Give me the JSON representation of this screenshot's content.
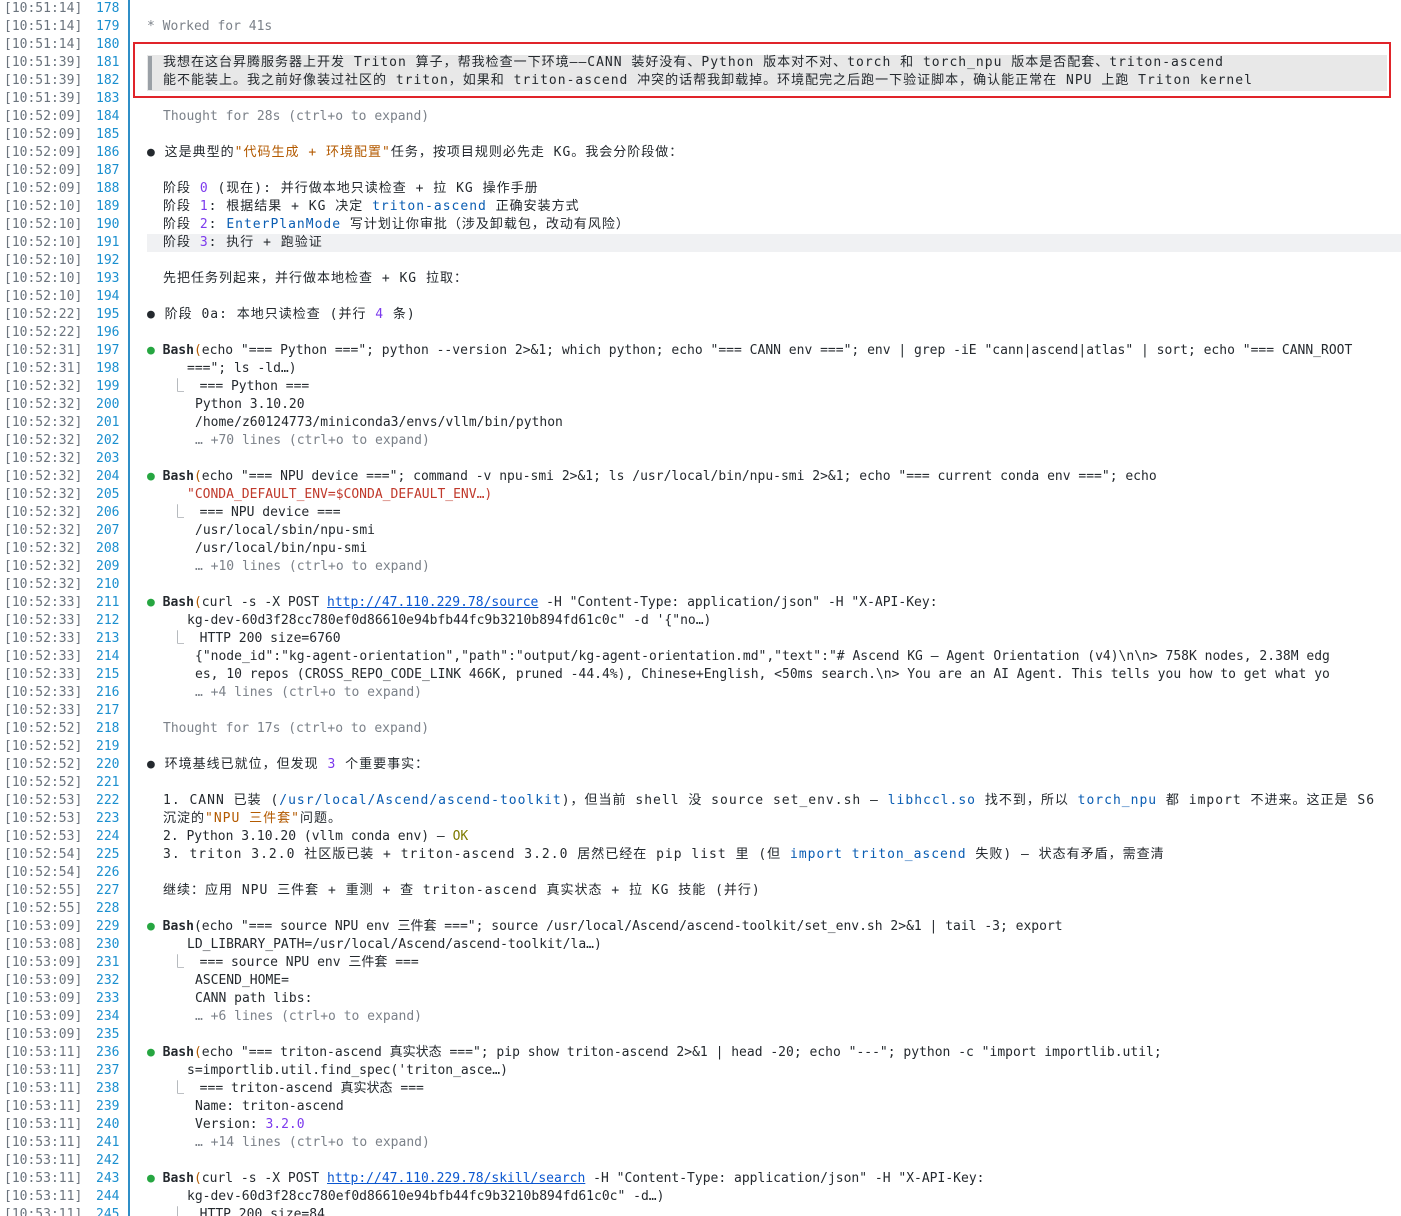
{
  "gutter": [
    {
      "ts": "[10:51:14]",
      "n": "178"
    },
    {
      "ts": "[10:51:14]",
      "n": "179"
    },
    {
      "ts": "[10:51:14]",
      "n": "180"
    },
    {
      "ts": "[10:51:39]",
      "n": "181"
    },
    {
      "ts": "[10:51:39]",
      "n": "182"
    },
    {
      "ts": "[10:51:39]",
      "n": "183"
    },
    {
      "ts": "[10:52:09]",
      "n": "184"
    },
    {
      "ts": "[10:52:09]",
      "n": "185"
    },
    {
      "ts": "[10:52:09]",
      "n": "186"
    },
    {
      "ts": "[10:52:09]",
      "n": "187"
    },
    {
      "ts": "[10:52:09]",
      "n": "188"
    },
    {
      "ts": "[10:52:10]",
      "n": "189"
    },
    {
      "ts": "[10:52:10]",
      "n": "190"
    },
    {
      "ts": "[10:52:10]",
      "n": "191"
    },
    {
      "ts": "[10:52:10]",
      "n": "192"
    },
    {
      "ts": "[10:52:10]",
      "n": "193"
    },
    {
      "ts": "[10:52:10]",
      "n": "194"
    },
    {
      "ts": "[10:52:22]",
      "n": "195"
    },
    {
      "ts": "[10:52:22]",
      "n": "196"
    },
    {
      "ts": "[10:52:31]",
      "n": "197"
    },
    {
      "ts": "[10:52:31]",
      "n": "198"
    },
    {
      "ts": "[10:52:32]",
      "n": "199"
    },
    {
      "ts": "[10:52:32]",
      "n": "200"
    },
    {
      "ts": "[10:52:32]",
      "n": "201"
    },
    {
      "ts": "[10:52:32]",
      "n": "202"
    },
    {
      "ts": "[10:52:32]",
      "n": "203"
    },
    {
      "ts": "[10:52:32]",
      "n": "204"
    },
    {
      "ts": "[10:52:32]",
      "n": "205"
    },
    {
      "ts": "[10:52:32]",
      "n": "206"
    },
    {
      "ts": "[10:52:32]",
      "n": "207"
    },
    {
      "ts": "[10:52:32]",
      "n": "208"
    },
    {
      "ts": "[10:52:32]",
      "n": "209"
    },
    {
      "ts": "[10:52:32]",
      "n": "210"
    },
    {
      "ts": "[10:52:33]",
      "n": "211"
    },
    {
      "ts": "[10:52:33]",
      "n": "212"
    },
    {
      "ts": "[10:52:33]",
      "n": "213"
    },
    {
      "ts": "[10:52:33]",
      "n": "214"
    },
    {
      "ts": "[10:52:33]",
      "n": "215"
    },
    {
      "ts": "[10:52:33]",
      "n": "216"
    },
    {
      "ts": "[10:52:33]",
      "n": "217"
    },
    {
      "ts": "[10:52:52]",
      "n": "218"
    },
    {
      "ts": "[10:52:52]",
      "n": "219"
    },
    {
      "ts": "[10:52:52]",
      "n": "220"
    },
    {
      "ts": "[10:52:52]",
      "n": "221"
    },
    {
      "ts": "[10:52:53]",
      "n": "222"
    },
    {
      "ts": "[10:52:53]",
      "n": "223"
    },
    {
      "ts": "[10:52:53]",
      "n": "224"
    },
    {
      "ts": "[10:52:54]",
      "n": "225"
    },
    {
      "ts": "[10:52:54]",
      "n": "226"
    },
    {
      "ts": "[10:52:55]",
      "n": "227"
    },
    {
      "ts": "[10:52:55]",
      "n": "228"
    },
    {
      "ts": "[10:53:09]",
      "n": "229"
    },
    {
      "ts": "[10:53:08]",
      "n": "230"
    },
    {
      "ts": "[10:53:09]",
      "n": "231"
    },
    {
      "ts": "[10:53:09]",
      "n": "232"
    },
    {
      "ts": "[10:53:09]",
      "n": "233"
    },
    {
      "ts": "[10:53:09]",
      "n": "234"
    },
    {
      "ts": "[10:53:09]",
      "n": "235"
    },
    {
      "ts": "[10:53:11]",
      "n": "236"
    },
    {
      "ts": "[10:53:11]",
      "n": "237"
    },
    {
      "ts": "[10:53:11]",
      "n": "238"
    },
    {
      "ts": "[10:53:11]",
      "n": "239"
    },
    {
      "ts": "[10:53:11]",
      "n": "240"
    },
    {
      "ts": "[10:53:11]",
      "n": "241"
    },
    {
      "ts": "[10:53:11]",
      "n": "242"
    },
    {
      "ts": "[10:53:11]",
      "n": "243"
    },
    {
      "ts": "[10:53:11]",
      "n": "244"
    },
    {
      "ts": "[10:53:11]",
      "n": "245"
    }
  ],
  "worked": "* Worked for 41s",
  "prompt": {
    "l1": "我想在这台昇腾服务器上开发 Triton 算子，帮我检查一下环境——CANN 装好没有、Python 版本对不对、torch 和 torch_npu 版本是否配套、triton-ascend",
    "l2": "能不能装上。我之前好像装过社区的 triton，如果和 triton-ascend 冲突的话帮我卸载掉。环境配完之后跑一下验证脚本，确认能正常在 NPU 上跑 Triton kernel"
  },
  "thought1": {
    "a": "Thought for 28s ",
    "b": "(ctrl+o to expand)"
  },
  "intro": {
    "a": "这是典型的",
    "b": "\"代码生成 + 环境配置\"",
    "c": "任务，按项目规则必先走 KG。我会分阶段做："
  },
  "stages": {
    "s0": {
      "a": "阶段 ",
      "n": "0",
      "b": " (现在): 并行做本地只读检查 + 拉 KG 操作手册"
    },
    "s1": {
      "a": "阶段 ",
      "n": "1",
      "b": ": 根据结果 + KG 决定 ",
      "c": "triton-ascend",
      "d": " 正确安装方式"
    },
    "s2": {
      "a": "阶段 ",
      "n": "2",
      "b": ": ",
      "c": "EnterPlanMode",
      "d": " 写计划让你审批（涉及卸载包，改动有风险）"
    },
    "s3": {
      "a": "阶段 ",
      "n": "3",
      "b": ": 执行 + 跑验证"
    }
  },
  "tasklist": "先把任务列起来，并行做本地检查 + KG 拉取：",
  "stage0a": {
    "a": "阶段 0a: 本地只读检查 (并行 ",
    "n": "4",
    "b": " 条)"
  },
  "bash1": {
    "l1": "echo \"=== Python ===\"; python --version 2>&1; which python; echo \"=== CANN env ===\"; env | grep -iE \"cann|ascend|atlas\" | sort; echo \"=== CANN_ROOT",
    "l2": "===\"; ls -ld…)",
    "o1": "=== Python ===",
    "o2": "Python 3.10.20",
    "o3": "/home/z60124773/miniconda3/envs/vllm/bin/python",
    "more": "… +70 lines ",
    "hint": "(ctrl+o to expand)"
  },
  "bash2": {
    "l1": "echo \"=== NPU device ===\"; command -v npu-smi 2>&1; ls /usr/local/bin/npu-smi 2>&1; echo \"=== current conda env ===\"; echo",
    "l2": "\"CONDA_DEFAULT_ENV=$CONDA_DEFAULT_ENV…)",
    "o1": "=== NPU device ===",
    "o2": "/usr/local/sbin/npu-smi",
    "o3": "/usr/local/bin/npu-smi",
    "more": "… +10 lines ",
    "hint": "(ctrl+o to expand)"
  },
  "bash3": {
    "pre": "curl -s -X POST ",
    "url": "http://47.110.229.78/source",
    "post": " -H \"Content-Type: application/json\" -H \"X-API-Key:",
    "l2": "kg-dev-60d3f28cc780ef0d86610e94bfb44fc9b3210b894fd61c0c\" -d '{\"no…)",
    "o1": "HTTP 200 size=6760",
    "o2": "{\"node_id\":\"kg-agent-orientation\",\"path\":\"output/kg-agent-orientation.md\",\"text\":\"# Ascend KG — Agent Orientation (v4)\\n\\n> 758K nodes, 2.38M edg",
    "o3": "es, 10 repos (CROSS_REPO_CODE_LINK 466K, pruned -44.4%), Chinese+English, <50ms search.\\n> You are an AI Agent. This tells you how to get what yo",
    "more": "… +4 lines ",
    "hint": "(ctrl+o to expand)"
  },
  "thought2": {
    "a": "Thought for 17s ",
    "b": "(ctrl+o to expand)"
  },
  "facts": {
    "a": "环境基线已就位，但发现 ",
    "n": "3",
    "b": " 个重要事实："
  },
  "fact1": {
    "a": "1. CANN 已装 (",
    "b": "/usr/local/Ascend/ascend-toolkit",
    "c": ")，但当前 shell 没 source set_env.sh — ",
    "d": "libhccl.so",
    "e": " 找不到，所以 ",
    "f": "torch_npu",
    "g": " 都 import 不进来。这正是 S6",
    "l2a": "沉淀的",
    "l2b": "\"NPU 三件套\"",
    "l2c": "问题。"
  },
  "fact2": {
    "a": "2. Python 3.10.20 (vllm conda env) — ",
    "b": "OK"
  },
  "fact3": {
    "a": "3. triton 3.2.0 社区版已装 + triton-ascend 3.2.0 居然已经在 pip list 里 (但 ",
    "b": "import triton_ascend",
    "c": " 失败) — 状态有矛盾，需查清"
  },
  "cont": "继续：应用 NPU 三件套 + 重测 + 查 triton-ascend 真实状态 + 拉 KG 技能 (并行)",
  "bash4": {
    "l1": "echo \"=== source NPU env 三件套 ===\"; source /usr/local/Ascend/ascend-toolkit/set_env.sh 2>&1 | tail -3; export",
    "l2": "LD_LIBRARY_PATH=/usr/local/Ascend/ascend-toolkit/la…)",
    "o1": "=== source NPU env 三件套 ===",
    "o2": "ASCEND_HOME=",
    "o3": "CANN path libs:",
    "more": "… +6 lines ",
    "hint": "(ctrl+o to expand)"
  },
  "bash5": {
    "l1": "echo \"=== triton-ascend 真实状态 ===\"; pip show triton-ascend 2>&1 | head -20; echo \"---\"; python -c \"import importlib.util;",
    "l2": "s=importlib.util.find_spec('triton_asce…)",
    "o1": "=== triton-ascend 真实状态 ===",
    "o2k": "Name: ",
    "o2v": "triton-ascend",
    "o3k": "Version: ",
    "o3v": "3.2.0",
    "more": "… +14 lines ",
    "hint": "(ctrl+o to expand)"
  },
  "bash6": {
    "pre": "curl -s -X POST ",
    "url": "http://47.110.229.78/skill/search",
    "post": " -H \"Content-Type: application/json\" -H \"X-API-Key:",
    "l2": "kg-dev-60d3f28cc780ef0d86610e94bfb44fc9b3210b894fd61c0c\" -d…)",
    "o1": "HTTP 200 size=84"
  },
  "bash_label": "Bash",
  "paren_open": "(",
  "bullet": "●",
  "corner": "⎿"
}
